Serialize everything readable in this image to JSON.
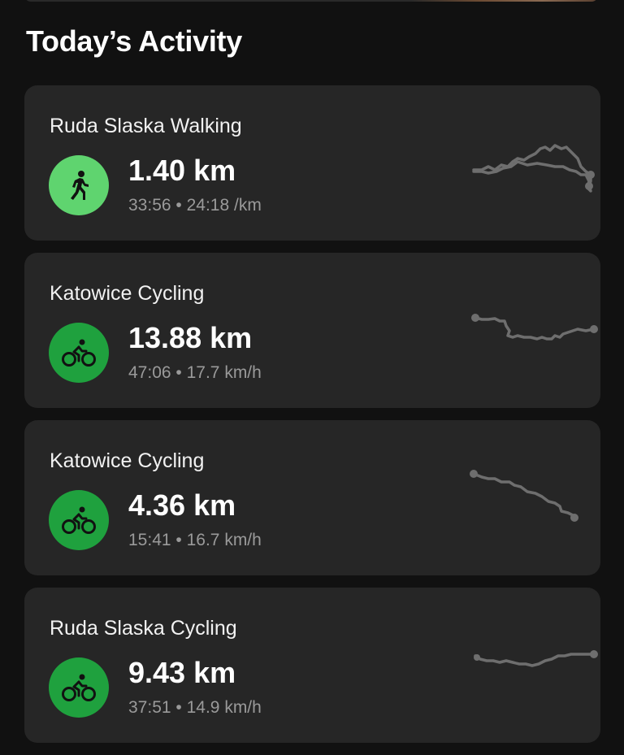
{
  "header": {
    "section_title": "Today’s Activity"
  },
  "colors": {
    "background": "#111111",
    "card": "#262626",
    "walking_icon_bg": "#5fd46f",
    "cycling_icon_bg": "#1fa13e",
    "route_line": "#6e6e6e",
    "secondary_text": "#9a9a9a"
  },
  "activities": [
    {
      "title": "Ruda Slaska Walking",
      "icon": "walking-icon",
      "distance": "1.40 km",
      "duration": "33:56",
      "separator": "•",
      "pace_or_speed": "24:18 /km"
    },
    {
      "title": "Katowice Cycling",
      "icon": "cycling-icon",
      "distance": "13.88 km",
      "duration": "47:06",
      "separator": "•",
      "pace_or_speed": "17.7 km/h"
    },
    {
      "title": "Katowice Cycling",
      "icon": "cycling-icon",
      "distance": "4.36 km",
      "duration": "15:41",
      "separator": "•",
      "pace_or_speed": "16.7 km/h"
    },
    {
      "title": "Ruda Slaska Cycling",
      "icon": "cycling-icon",
      "distance": "9.43 km",
      "duration": "37:51",
      "separator": "•",
      "pace_or_speed": "14.9 km/h"
    }
  ]
}
